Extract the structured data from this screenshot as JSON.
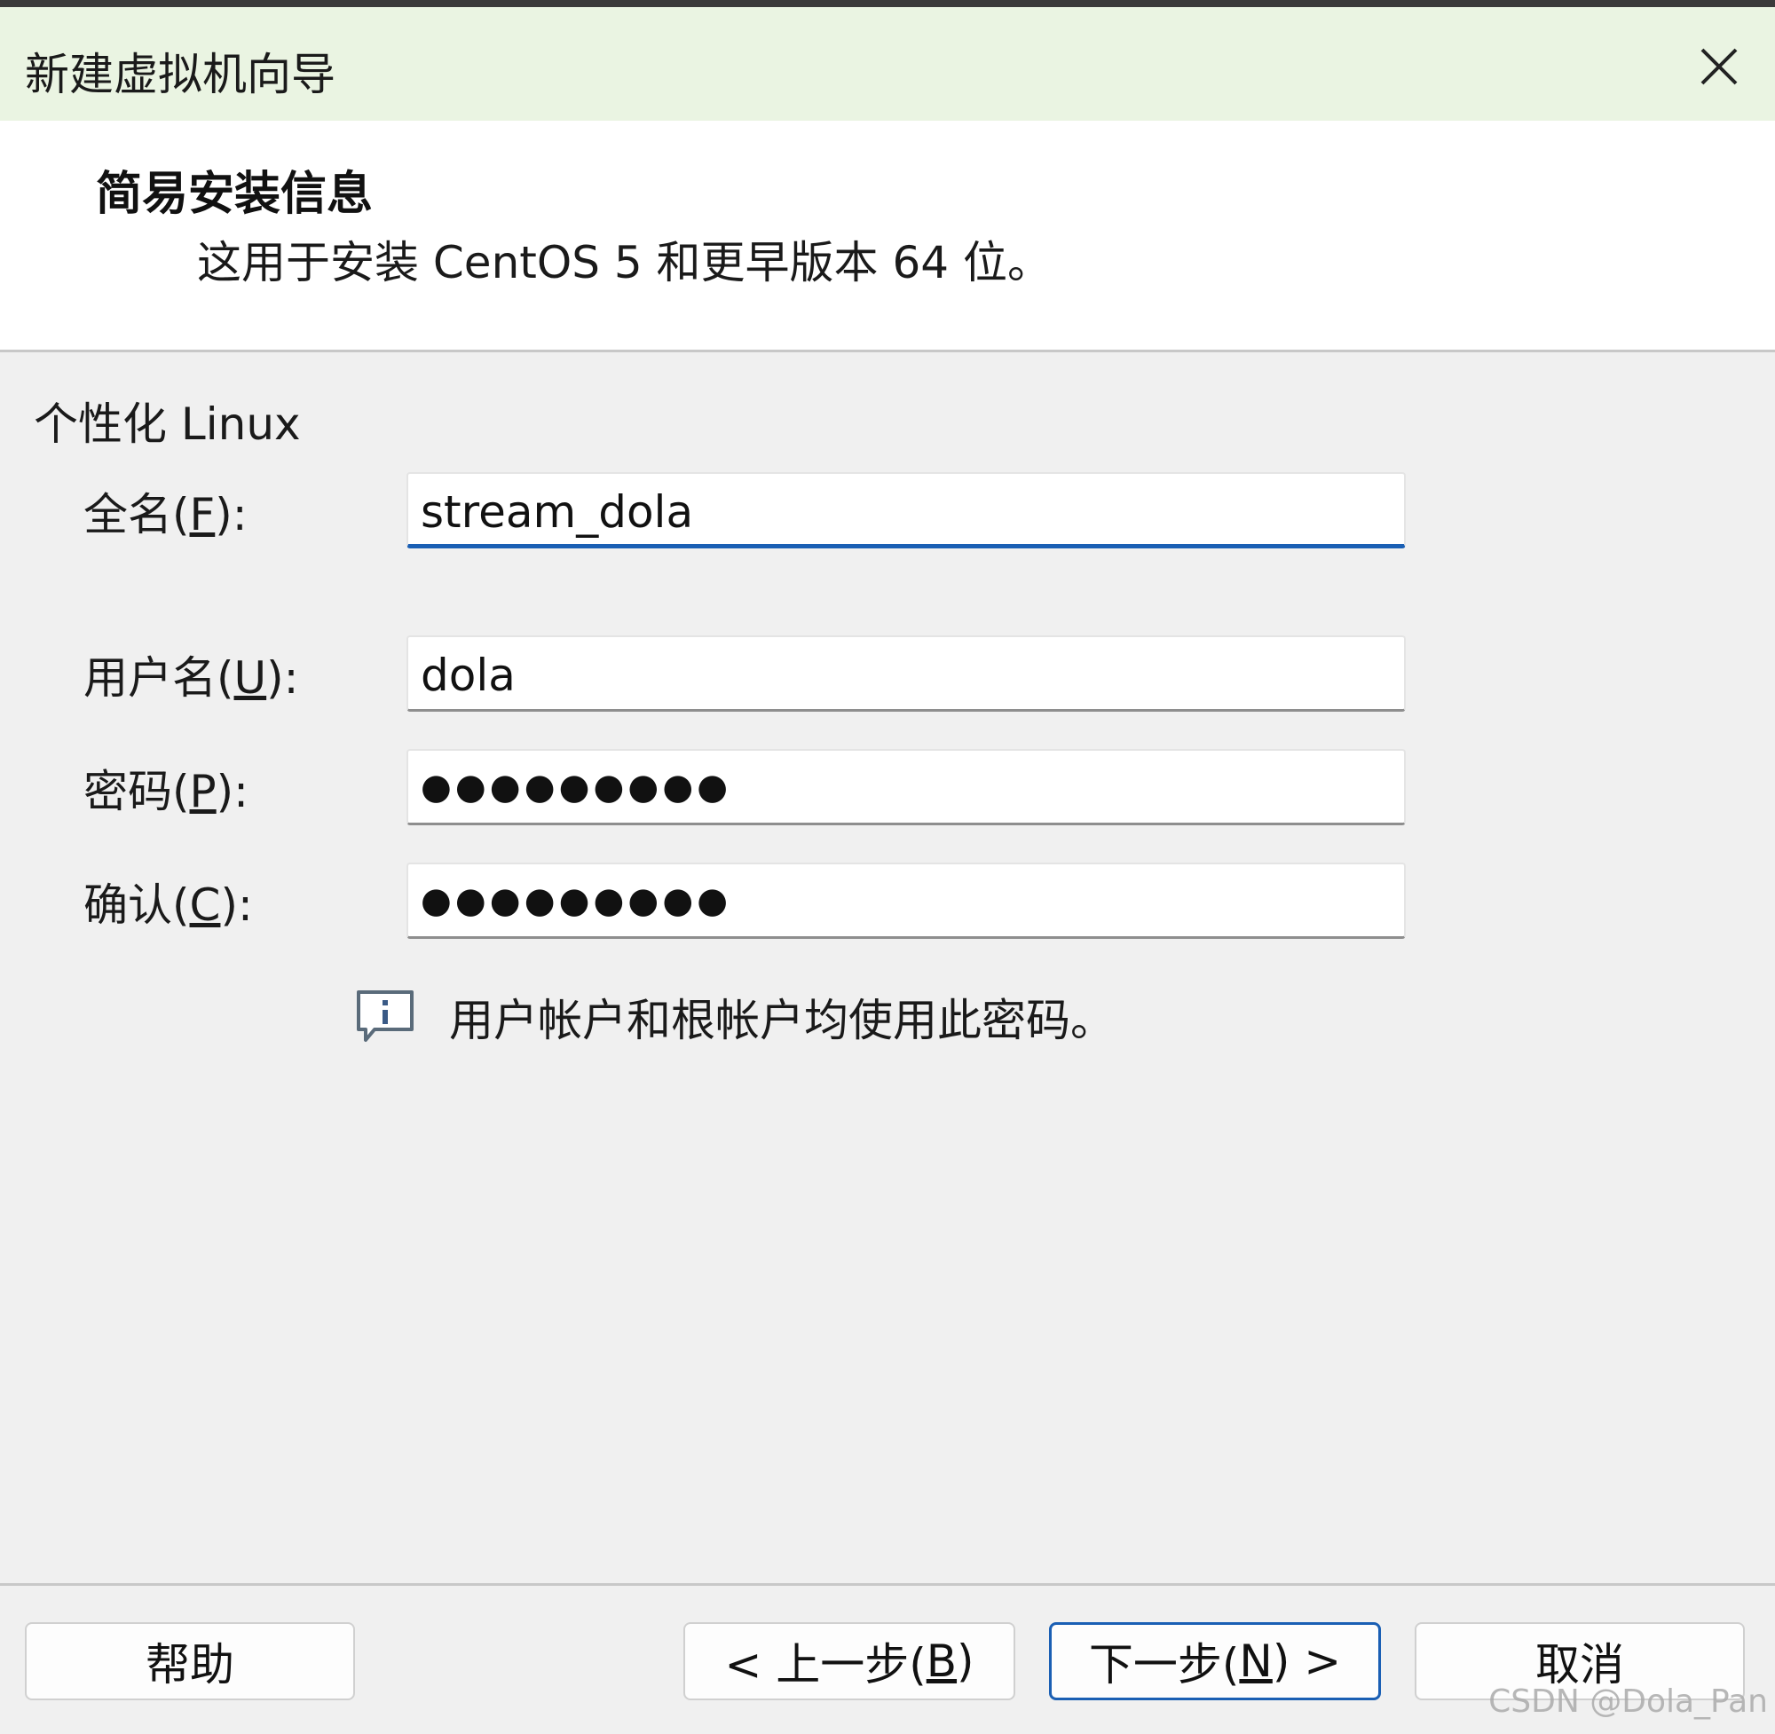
{
  "window": {
    "title": "新建虚拟机向导",
    "close_icon": "close-icon"
  },
  "header": {
    "title": "简易安装信息",
    "subtitle": "这用于安装 CentOS 5 和更早版本 64 位。"
  },
  "section": {
    "label": "个性化 Linux"
  },
  "fields": {
    "fullname": {
      "label_prefix": "全名(",
      "accel": "F",
      "label_suffix": "):",
      "value": "stream_dola"
    },
    "username": {
      "label_prefix": "用户名(",
      "accel": "U",
      "label_suffix": "):",
      "value": "dola"
    },
    "password": {
      "label_prefix": "密码(",
      "accel": "P",
      "label_suffix": "):",
      "value": "●●●●●●●●●"
    },
    "confirm": {
      "label_prefix": "确认(",
      "accel": "C",
      "label_suffix": "):",
      "value": "●●●●●●●●●"
    }
  },
  "info": {
    "icon": "info-icon",
    "text": "用户帐户和根帐户均使用此密码。"
  },
  "buttons": {
    "help": "帮助",
    "back_prefix": "< 上一步(",
    "back_accel": "B",
    "back_suffix": ")",
    "next_prefix": "下一步(",
    "next_accel": "N",
    "next_suffix": ") >",
    "cancel": "取消"
  },
  "watermark": "CSDN @Dola_Pan",
  "colors": {
    "titlebar_bg": "#eaf4e2",
    "accent": "#1a5fb4",
    "body_bg": "#f0f0f0"
  }
}
